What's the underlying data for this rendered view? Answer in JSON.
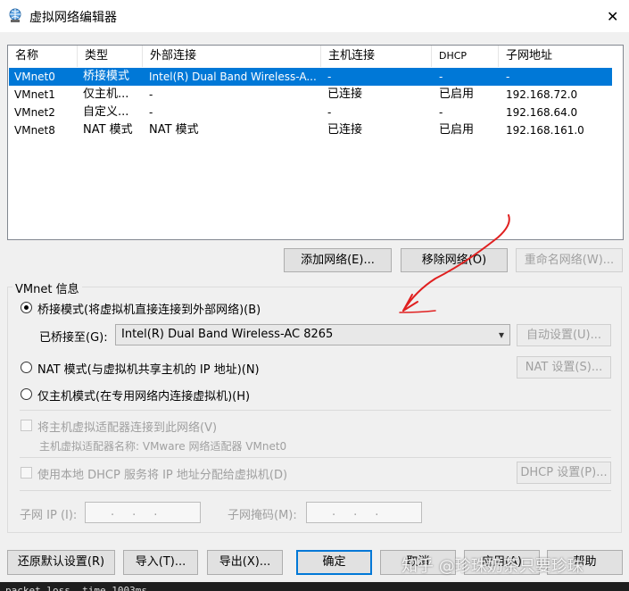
{
  "window": {
    "title": "虚拟网络编辑器",
    "close_label": "✕"
  },
  "list": {
    "headers": [
      "名称",
      "类型",
      "外部连接",
      "主机连接",
      "DHCP",
      "子网地址"
    ],
    "rows": [
      {
        "name": "VMnet0",
        "type": "桥接模式",
        "external": "Intel(R) Dual Band Wireless-A...",
        "host": "-",
        "dhcp": "-",
        "subnet": "-"
      },
      {
        "name": "VMnet1",
        "type": "仅主机...",
        "external": "-",
        "host": "已连接",
        "dhcp": "已启用",
        "subnet": "192.168.72.0"
      },
      {
        "name": "VMnet2",
        "type": "自定义...",
        "external": "-",
        "host": "-",
        "dhcp": "-",
        "subnet": "192.168.64.0"
      },
      {
        "name": "VMnet8",
        "type": "NAT 模式",
        "external": "NAT 模式",
        "host": "已连接",
        "dhcp": "已启用",
        "subnet": "192.168.161.0"
      }
    ],
    "selected_index": 0
  },
  "list_buttons": {
    "add": "添加网络(E)...",
    "remove": "移除网络(O)",
    "rename": "重命名网络(W)..."
  },
  "vmnet_info": {
    "legend": "VMnet 信息",
    "bridged_label": "桥接模式(将虚拟机直接连接到外部网络)(B)",
    "bridged_to_label": "已桥接至(G):",
    "bridged_to_value": "Intel(R) Dual Band Wireless-AC 8265",
    "auto_settings": "自动设置(U)...",
    "nat_label": "NAT 模式(与虚拟机共享主机的 IP 地址)(N)",
    "nat_settings": "NAT 设置(S)...",
    "hostonly_label": "仅主机模式(在专用网络内连接虚拟机)(H)",
    "connect_adapter_label": "将主机虚拟适配器连接到此网络(V)",
    "adapter_name_label": "主机虚拟适配器名称: VMware 网络适配器 VMnet0",
    "dhcp_label": "使用本地 DHCP 服务将 IP 地址分配给虚拟机(D)",
    "dhcp_settings": "DHCP 设置(P)...",
    "subnet_ip_label": "子网 IP (I):",
    "subnet_ip_value": "...",
    "subnet_mask_label": "子网掩码(M):",
    "subnet_mask_value": "...",
    "selected_mode": "bridged"
  },
  "footer_buttons": {
    "restore": "还原默认设置(R)",
    "import": "导入(T)...",
    "export": "导出(X)...",
    "ok": "确定",
    "cancel": "取消",
    "apply": "应用(A)",
    "help": "帮助"
  },
  "watermark": "知乎 @珍珠奶茶只要珍珠",
  "terminal_text": "packet loss, time 1003ms",
  "colors": {
    "selection": "#0078d7",
    "annotation_arrow": "#e02020"
  }
}
